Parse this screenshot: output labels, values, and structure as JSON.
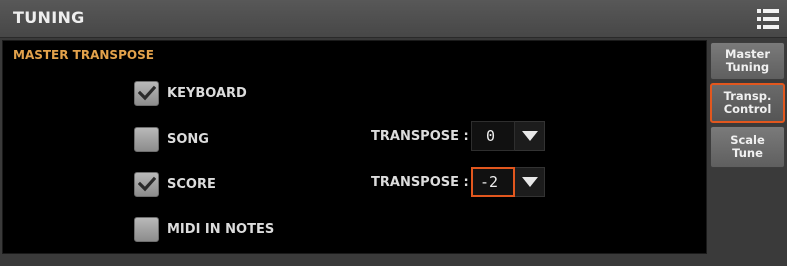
{
  "header": {
    "title": "TUNING",
    "menu_icon": "list-menu-icon"
  },
  "panel": {
    "section_title": "MASTER TRANSPOSE",
    "options": [
      {
        "label": "KEYBOARD",
        "checked": true
      },
      {
        "label": "SONG",
        "checked": false
      },
      {
        "label": "SCORE",
        "checked": true
      },
      {
        "label": "MIDI IN NOTES",
        "checked": false
      }
    ],
    "song_transpose": {
      "label": "TRANSPOSE :",
      "value": "0"
    },
    "score_transpose": {
      "label": "TRANSPOSE :",
      "value": "-2"
    }
  },
  "sidebar": {
    "tabs": [
      {
        "line1": "Master",
        "line2": "Tuning",
        "active": false
      },
      {
        "line1": "Transp.",
        "line2": "Control",
        "active": true
      },
      {
        "line1": "Scale",
        "line2": "Tune",
        "active": false
      }
    ]
  },
  "colors": {
    "accent": "#e2571e",
    "section_title": "#e3a24b"
  }
}
